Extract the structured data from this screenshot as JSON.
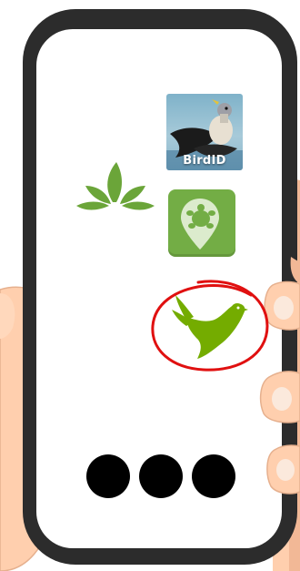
{
  "apps": {
    "birdid": {
      "label": "BirdID",
      "icon": "bird-photo-icon"
    },
    "plantnet": {
      "icon": "leaf-sprout-icon",
      "color": "#6ba539"
    },
    "location": {
      "icon": "map-pin-turtle-icon",
      "color": "#73ad45"
    },
    "inaturalist": {
      "icon": "green-bird-icon",
      "color": "#74ac00",
      "highlighted": true
    }
  },
  "annotation": {
    "circle_color": "#e01010"
  },
  "nav_dots": {
    "count": 3,
    "color": "#000000"
  },
  "colors": {
    "phone_frame": "#2c2c2c",
    "skin": "#ffcfae",
    "skin_shadow": "#f2b896",
    "nail": "#fbe9dc"
  }
}
